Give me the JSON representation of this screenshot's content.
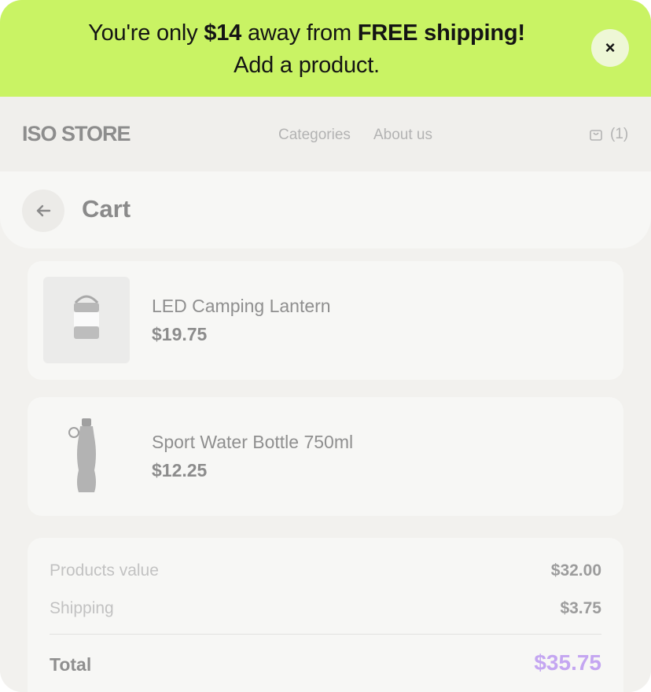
{
  "banner": {
    "text_prefix": "You're only ",
    "amount": "$14",
    "text_middle": " away from ",
    "highlight": "FREE shipping!",
    "line2": "Add a product.",
    "close_label": "×",
    "color": "#c9f364"
  },
  "nav": {
    "logo": "ISO STORE",
    "links": [
      "Categories",
      "About us"
    ],
    "cart_count": "(1)"
  },
  "cart": {
    "title": "Cart",
    "items": [
      {
        "name": "LED Camping Lantern",
        "price": "$19.75",
        "icon": "lantern-image"
      },
      {
        "name": "Sport Water Bottle 750ml",
        "price": "$12.25",
        "icon": "bottle-image"
      }
    ]
  },
  "summary": {
    "products_label": "Products value",
    "products_value": "$32.00",
    "shipping_label": "Shipping",
    "shipping_value": "$3.75",
    "total_label": "Total",
    "total_value": "$35.75",
    "total_color": "#c4a6f1"
  }
}
